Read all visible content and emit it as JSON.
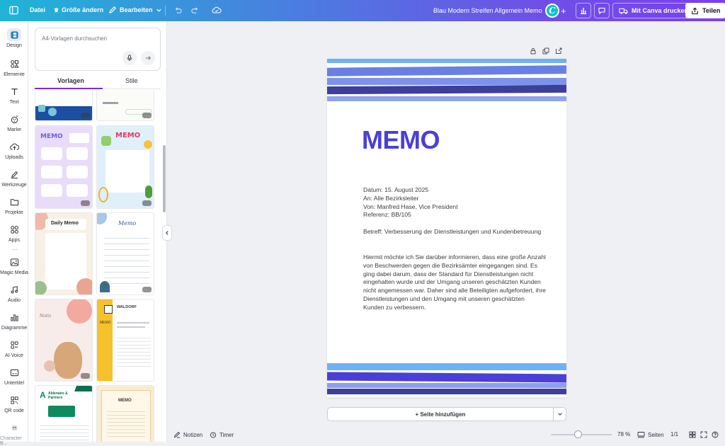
{
  "topbar": {
    "menu_file": "Datei",
    "resize": "Größe ändern",
    "edit": "Bearbeiten",
    "doc_title": "Blau Modern Streifen Allgemein Memo",
    "avatar_letter": "C",
    "print": "Mit Canva drucken",
    "share": "Teilen"
  },
  "rail": [
    {
      "label": "Design",
      "icon": "design-icon"
    },
    {
      "label": "Elemente",
      "icon": "elements-icon"
    },
    {
      "label": "Text",
      "icon": "text-icon"
    },
    {
      "label": "Marke",
      "icon": "brand-icon"
    },
    {
      "label": "Uploads",
      "icon": "upload-icon"
    },
    {
      "label": "Werkzeuge",
      "icon": "tools-icon"
    },
    {
      "label": "Projekte",
      "icon": "folder-icon"
    },
    {
      "label": "Apps",
      "icon": "apps-icon"
    },
    {
      "label": "Magic Media",
      "icon": "magic-media-icon"
    },
    {
      "label": "Audio",
      "icon": "audio-icon"
    },
    {
      "label": "Diagramme",
      "icon": "chart-icon"
    },
    {
      "label": "AI Voice",
      "icon": "ai-voice-icon"
    },
    {
      "label": "Untertitel",
      "icon": "subtitles-icon"
    },
    {
      "label": "QR code",
      "icon": "qr-icon"
    },
    {
      "label": "Character B...",
      "icon": "character-icon"
    }
  ],
  "panel": {
    "search_placeholder": "A4-Vorlagen durchsuchen",
    "tab_templates": "Vorlagen",
    "tab_styles": "Stile"
  },
  "templates": [
    {
      "title": "MEMO"
    },
    {
      "title": "MEMO"
    },
    {
      "title": "Daily Memo"
    },
    {
      "title": "Memo"
    },
    {
      "title": "Notiz"
    },
    {
      "title": "MEMO",
      "brand": "WALDORF"
    },
    {
      "title": "Aldenaire & Partners"
    },
    {
      "title": "MEMO"
    }
  ],
  "document": {
    "title": "MEMO",
    "header_lines": [
      "Datum: 15. August 2025",
      "An: Alle Bezirksleiter",
      "Von: Manfred Hase, Vice President",
      "Referenz: BB/105"
    ],
    "subject": "Betreff: Verbesserung der Dienstleistungen und Kundenbetreuung",
    "body": "Hiermit möchte ich Sie darüber informieren, dass eine große Anzahl von Beschwerden gegen die Bezirksämter eingegangen sind. Es ging dabei darum, dass der Standard für Dienstleistungen nicht eingehalten wurde und der Umgang unseren geschätzten Kunden nicht angemessen war. Daher sind alle Beteiligten aufgefordert, ihre Dienstleistungen und den Umgang mit unseren geschätzten Kunden zu verbessern.",
    "stripe_colors": [
      "#6a9bf0",
      "#4b3fd8",
      "#8a9ee6",
      "#3d3f9a"
    ]
  },
  "canvas": {
    "add_page": "+ Seite hinzufügen"
  },
  "bottom": {
    "notes": "Notizen",
    "timer": "Timer",
    "zoom": "78 %",
    "zoom_level": 0.45,
    "pages": "Seiten",
    "page_count": "1/1"
  },
  "colors": {
    "accent": "#7d2ae8",
    "memo_title": "#4b3fd8"
  }
}
